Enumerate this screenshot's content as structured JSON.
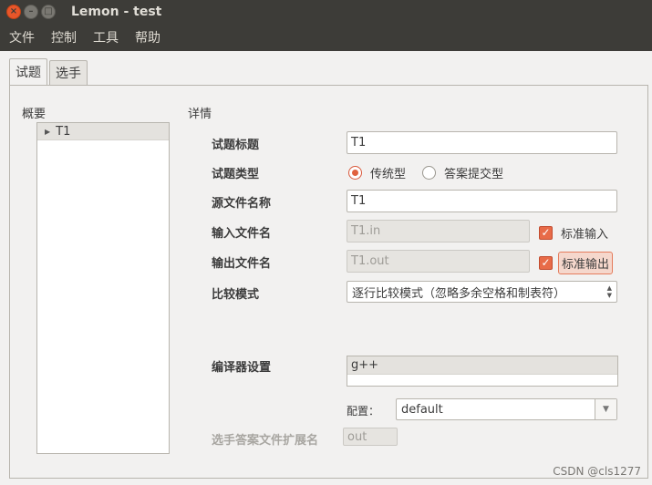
{
  "window": {
    "title": "Lemon - test",
    "close_glyph": "×",
    "min_glyph": "–",
    "max_glyph": "□"
  },
  "menu": [
    "文件",
    "控制",
    "工具",
    "帮助"
  ],
  "tabs": [
    {
      "label": "试题",
      "active": true
    },
    {
      "label": "选手",
      "active": false
    }
  ],
  "overview": {
    "label": "概要",
    "tree": [
      {
        "label": "T1",
        "expanded": false
      }
    ]
  },
  "details": {
    "label": "详情",
    "title_label": "试题标题",
    "title_value": "T1",
    "type_label": "试题类型",
    "type_options": [
      {
        "label": "传统型",
        "checked": true
      },
      {
        "label": "答案提交型",
        "checked": false
      }
    ],
    "source_label": "源文件名称",
    "source_value": "T1",
    "input_label": "输入文件名",
    "input_value": "T1.in",
    "stdin_label": "标准输入",
    "stdin_checked": true,
    "output_label": "输出文件名",
    "output_value": "T1.out",
    "stdout_label": "标准输出",
    "stdout_checked": true,
    "compare_label": "比较模式",
    "compare_value": "逐行比较模式（忽略多余空格和制表符）",
    "compiler_label": "编译器设置",
    "compilers": [
      "g++"
    ],
    "config_label": "配置：",
    "config_value": "default",
    "ext_label": "选手答案文件扩展名",
    "ext_value": "out"
  },
  "watermark": "CSDN @cls1277",
  "colors": {
    "titlebar": "#3d3c38",
    "accent": "#e86b48",
    "background": "#f2f1f0"
  }
}
